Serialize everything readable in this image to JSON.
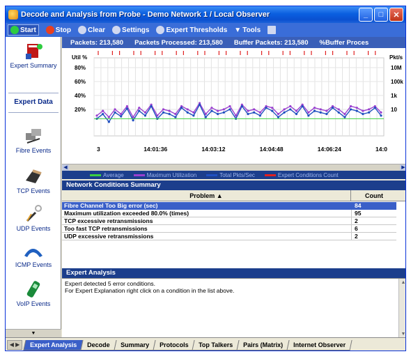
{
  "window": {
    "title": "Decode and Analysis from Probe - Demo Network 1 / Local Observer",
    "controls": [
      "minimize",
      "maximize",
      "close"
    ]
  },
  "toolbar": {
    "items": [
      {
        "label": "Start",
        "icon": "start-icon",
        "color": "#2ecc40"
      },
      {
        "label": "Stop",
        "icon": "stop-icon",
        "color": "#e84020"
      },
      {
        "label": "Clear",
        "icon": "clear-icon",
        "color": "#d0d8f0"
      },
      {
        "label": "Settings",
        "icon": "settings-icon",
        "color": "#d0d8f0"
      },
      {
        "label": "Expert Thresholds",
        "icon": "thresholds-icon",
        "color": "#d0d8f0"
      },
      {
        "label": "Tools",
        "icon": "tools-icon",
        "color": "#d0d8f0"
      },
      {
        "label": "",
        "icon": "document-icon",
        "color": "#d0d8f0"
      }
    ]
  },
  "sidebar": {
    "expert_summary": "Expert Summary",
    "expert_data": "Expert Data",
    "items": [
      {
        "label": "Fibre Events",
        "icon": "fibre-events-icon"
      },
      {
        "label": "TCP Events",
        "icon": "tcp-events-icon"
      },
      {
        "label": "UDP Events",
        "icon": "udp-events-icon"
      },
      {
        "label": "ICMP Events",
        "icon": "icmp-events-icon"
      },
      {
        "label": "VoIP Events",
        "icon": "voip-events-icon"
      }
    ]
  },
  "stats": {
    "packets": "Packets: 213,580",
    "processed": "Packets Processed: 213,580",
    "buffer": "Buffer Packets: 213,580",
    "buffer_pct": "%Buffer Proces"
  },
  "chart_data": {
    "type": "line",
    "left_axis_label": "Util %",
    "right_axis_label": "Pkt/s",
    "left_ticks": [
      "80%",
      "60%",
      "40%",
      "20%"
    ],
    "right_ticks": [
      "10M",
      "100k",
      "1k",
      "10"
    ],
    "x_ticks": [
      "3",
      "14:01:36",
      "14:03:12",
      "14:04:48",
      "14:06:24",
      "14:0"
    ],
    "legend": [
      {
        "name": "Average",
        "color": "#3cd040"
      },
      {
        "name": "Maximum Utilization",
        "color": "#9a40d0"
      },
      {
        "name": "Total Pkts/Sec",
        "color": "#2050c0"
      },
      {
        "name": "Expert Conditions Count",
        "color": "#e02020"
      }
    ],
    "series": [
      {
        "name": "Total Pkts/Sec",
        "values": [
          22,
          28,
          18,
          30,
          25,
          35,
          20,
          32,
          26,
          38,
          22,
          30,
          28,
          24,
          36,
          30,
          26,
          40,
          24,
          32,
          28,
          30,
          34,
          22,
          38,
          28,
          30,
          26,
          36,
          32,
          24,
          30,
          34,
          28,
          38,
          26,
          32,
          30,
          28,
          36,
          30,
          24,
          34,
          32,
          28,
          30,
          36,
          26
        ]
      },
      {
        "name": "Maximum Utilization",
        "values": [
          26,
          32,
          24,
          34,
          28,
          38,
          24,
          36,
          30,
          40,
          26,
          34,
          32,
          28,
          38,
          34,
          30,
          42,
          28,
          36,
          32,
          34,
          38,
          26,
          40,
          32,
          34,
          30,
          38,
          36,
          28,
          34,
          38,
          32,
          40,
          30,
          36,
          34,
          32,
          38,
          34,
          28,
          38,
          36,
          32,
          34,
          38,
          30
        ]
      }
    ]
  },
  "network_conditions": {
    "heading": "Network Conditions Summary",
    "columns": [
      "Problem",
      "Count"
    ],
    "rows": [
      {
        "problem": "Fibre Channel Too Big error (sec)",
        "count": "84",
        "selected": true
      },
      {
        "problem": "Maximum utilization exceeded 80.0% (times)",
        "count": "95",
        "selected": false
      },
      {
        "problem": "TCP excessive retransmissions",
        "count": "2",
        "selected": false
      },
      {
        "problem": "Too fast TCP retransmissions",
        "count": "6",
        "selected": false
      },
      {
        "problem": "UDP excessive retransmissions",
        "count": "2",
        "selected": false
      }
    ]
  },
  "expert_analysis": {
    "heading": "Expert Analysis",
    "line1": "Expert detected 5 error conditions.",
    "line2": "For Expert Explanation right click on a condition in the list above."
  },
  "tabs": [
    {
      "label": "Expert Analysis",
      "active": true
    },
    {
      "label": "Decode",
      "active": false
    },
    {
      "label": "Summary",
      "active": false
    },
    {
      "label": "Protocols",
      "active": false
    },
    {
      "label": "Top Talkers",
      "active": false
    },
    {
      "label": "Pairs (Matrix)",
      "active": false
    },
    {
      "label": "Internet Observer",
      "active": false
    }
  ]
}
